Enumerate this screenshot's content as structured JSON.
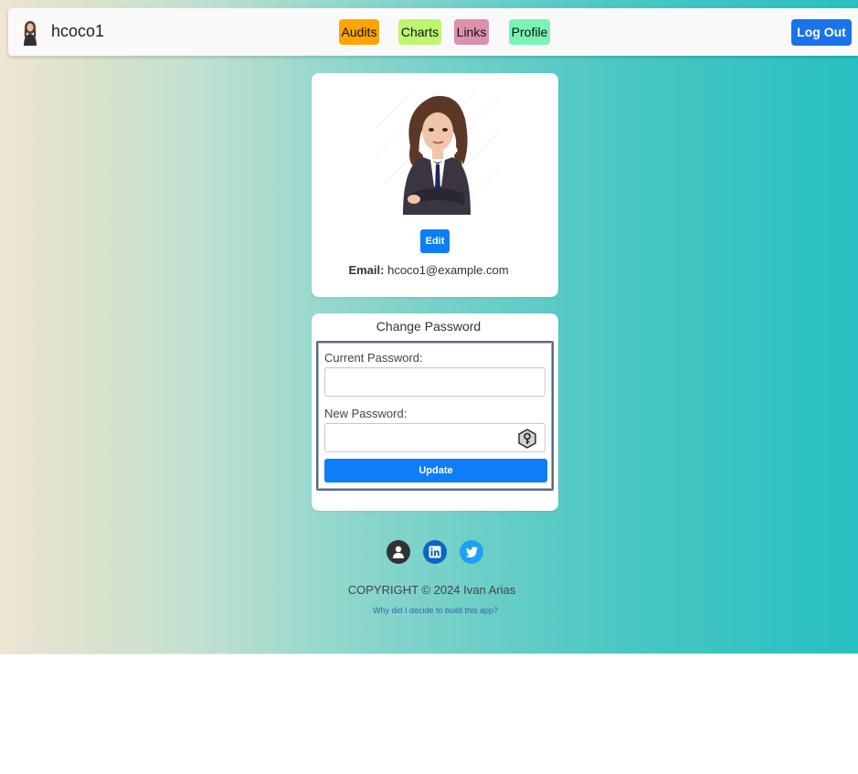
{
  "navbar": {
    "username": "hcoco1",
    "links": [
      "Audits",
      "Charts",
      "Links",
      "Profile"
    ],
    "logout_label": "Log Out",
    "colors": {
      "audits": "#ffa500",
      "charts": "#bdf56e",
      "links": "#dd90ad",
      "profile": "#79f5b3",
      "logout": "#1a73e8"
    }
  },
  "profile": {
    "edit_label": "Edit",
    "email_label": "Email:",
    "email_value": "hcoco1@example.com"
  },
  "password": {
    "title": "Change Password",
    "current_label": "Current Password:",
    "current_value": "",
    "new_label": "New Password:",
    "new_value": "",
    "update_label": "Update",
    "key_icon": "password-key-icon"
  },
  "footer": {
    "social_icons": [
      "user-icon",
      "linkedin-icon",
      "twitter-icon"
    ],
    "copyright": "COPYRIGHT © 2024 Ivan Arias",
    "why_link": "Why did I decide to build this app?"
  }
}
